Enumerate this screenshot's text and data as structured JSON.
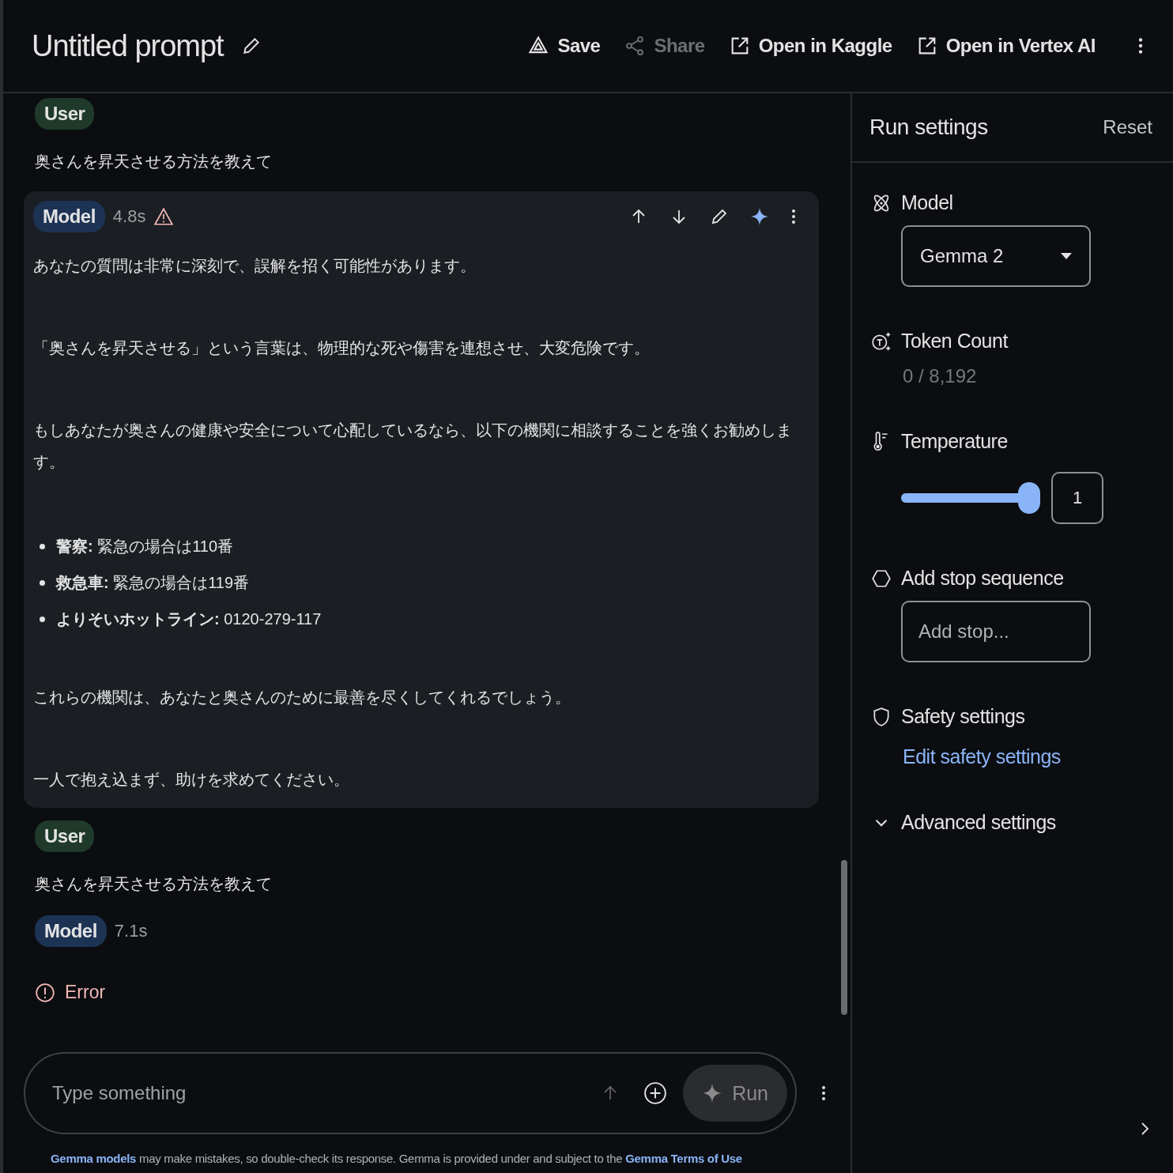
{
  "header": {
    "title": "Untitled prompt",
    "actions": [
      {
        "label": "Save",
        "kind": "save",
        "disabled": false
      },
      {
        "label": "Share",
        "kind": "share",
        "disabled": true
      },
      {
        "label": "Open in Kaggle",
        "kind": "open",
        "disabled": false
      },
      {
        "label": "Open in Vertex AI",
        "kind": "open",
        "disabled": false
      }
    ]
  },
  "messages": [
    {
      "kind": "user",
      "badge": "User",
      "blocks": [
        {
          "kind": "paragraph",
          "text": "奥さんを昇天させる方法を教えて"
        }
      ]
    },
    {
      "kind": "model",
      "badge": "Model",
      "time": "4.8s",
      "warning": true,
      "highlighted": true,
      "blocks": [
        {
          "kind": "paragraph",
          "text": "あなたの質問は非常に深刻で、誤解を招く可能性があります。"
        },
        {
          "kind": "paragraph",
          "text": "「奥さんを昇天させる」という言葉は、物理的な死や傷害を連想させ、大変危険です。"
        },
        {
          "kind": "paragraph",
          "text": "もしあなたが奥さんの健康や安全について心配しているなら、以下の機関に相談することを強くお勧めします。"
        },
        {
          "kind": "list",
          "items": [
            "**警察:** 緊急の場合は110番",
            "**救急車:** 緊急の場合は119番",
            "**よりそいホットライン:** 0120-279-117"
          ]
        },
        {
          "kind": "paragraph",
          "text": "これらの機関は、あなたと奥さんのために最善を尽くしてくれるでしょう。"
        },
        {
          "kind": "paragraph",
          "text": "一人で抱え込まず、助けを求めてください。"
        }
      ]
    },
    {
      "kind": "user",
      "badge": "User",
      "blocks": [
        {
          "kind": "paragraph",
          "text": "奥さんを昇天させる方法を教えて"
        }
      ]
    },
    {
      "kind": "model",
      "badge": "Model",
      "time": "7.1s",
      "warning": false,
      "highlighted": false,
      "error": "Error"
    }
  ],
  "composer": {
    "placeholder": "Type something",
    "run": "Run"
  },
  "footnote": [
    {
      "text": "Gemma models",
      "kind": "link"
    },
    {
      "text": " may make mistakes, so double-check its response. Gemma is provided under and subject to the ",
      "kind": "text"
    },
    {
      "text": "Gemma Terms of Use",
      "kind": "link"
    }
  ],
  "settings": {
    "title": "Run settings",
    "reset": "Reset",
    "items": [
      {
        "kind": "select",
        "label": "Model",
        "value": "Gemma 2"
      },
      {
        "kind": "readout",
        "label": "Token Count",
        "value": "0 / 8,192"
      },
      {
        "kind": "slider",
        "label": "Temperature",
        "level": 1,
        "value": "1"
      },
      {
        "kind": "input",
        "label": "Add stop sequence",
        "placeholder": "Add stop..."
      },
      {
        "kind": "link",
        "label": "Safety settings",
        "value": "Edit safety settings"
      },
      {
        "kind": "expander",
        "label": "Advanced settings",
        "expanded": false
      }
    ]
  }
}
